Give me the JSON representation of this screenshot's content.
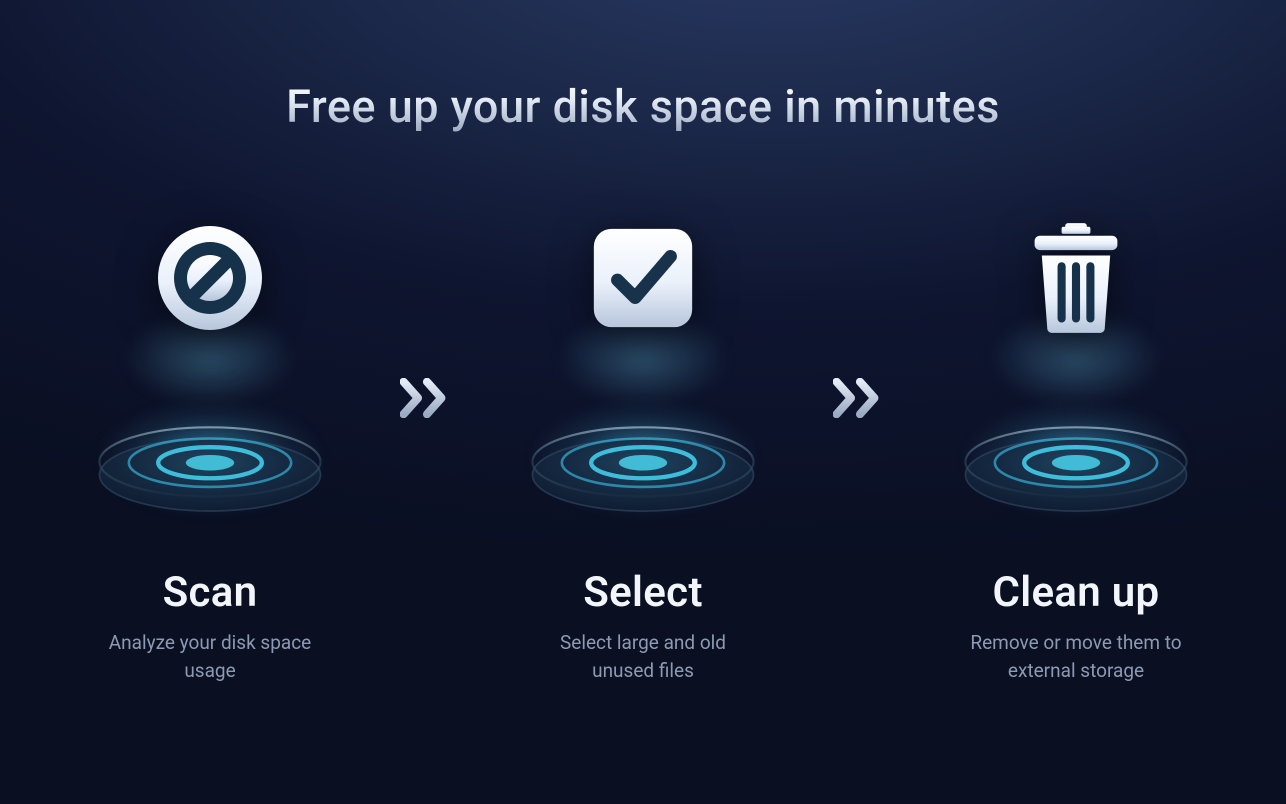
{
  "headline": "Free up your disk space in minutes",
  "steps": [
    {
      "icon": "gauge-icon",
      "title": "Scan",
      "description": "Analyze your disk space usage"
    },
    {
      "icon": "checkbox-icon",
      "title": "Select",
      "description": "Select large and old unused files"
    },
    {
      "icon": "trash-icon",
      "title": "Clean up",
      "description": "Remove or move them to external storage"
    }
  ]
}
